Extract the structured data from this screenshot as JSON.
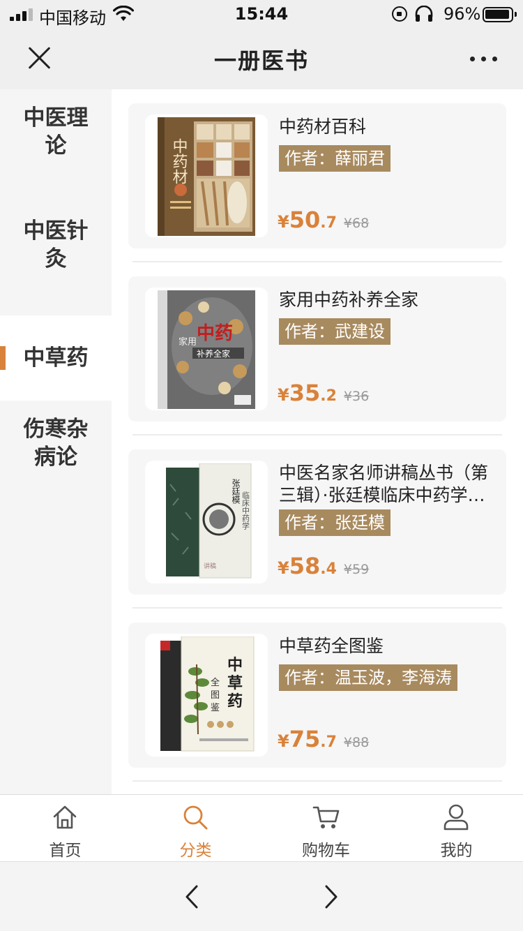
{
  "status_bar": {
    "carrier": "中国移动",
    "time": "15:44",
    "battery": "96%"
  },
  "header": {
    "title": "一册医书"
  },
  "sidebar": {
    "items": [
      {
        "label": "中医理论",
        "active": false
      },
      {
        "label": "中医针灸",
        "active": false
      },
      {
        "label": "中草药",
        "active": true
      },
      {
        "label": "伤寒杂病论",
        "active": false
      }
    ]
  },
  "products": [
    {
      "title": "中药材百科",
      "author": "作者：薛丽君",
      "price_int": "50",
      "price_dec": ".7",
      "currency": "¥",
      "original_price": "¥68"
    },
    {
      "title": "家用中药补养全家",
      "author": "作者：武建设",
      "price_int": "35",
      "price_dec": ".2",
      "currency": "¥",
      "original_price": "¥36"
    },
    {
      "title": "中医名家名师讲稿丛书（第三辑）·张廷模临床中药学讲稿",
      "author": "作者：张廷模",
      "price_int": "58",
      "price_dec": ".4",
      "currency": "¥",
      "original_price": "¥59"
    },
    {
      "title": "中草药全图鉴",
      "author": "作者：温玉波，李海涛",
      "price_int": "75",
      "price_dec": ".7",
      "currency": "¥",
      "original_price": "¥88"
    }
  ],
  "tab_bar": {
    "items": [
      {
        "label": "首页",
        "icon": "home-icon",
        "active": false
      },
      {
        "label": "分类",
        "icon": "search-icon",
        "active": true
      },
      {
        "label": "购物车",
        "icon": "cart-icon",
        "active": false
      },
      {
        "label": "我的",
        "icon": "user-icon",
        "active": false
      }
    ]
  },
  "colors": {
    "accent": "#d9823a",
    "author_tag": "#a88a5f",
    "card_bg": "#f6f6f6",
    "sidebar_bg": "#f5f5f5"
  }
}
